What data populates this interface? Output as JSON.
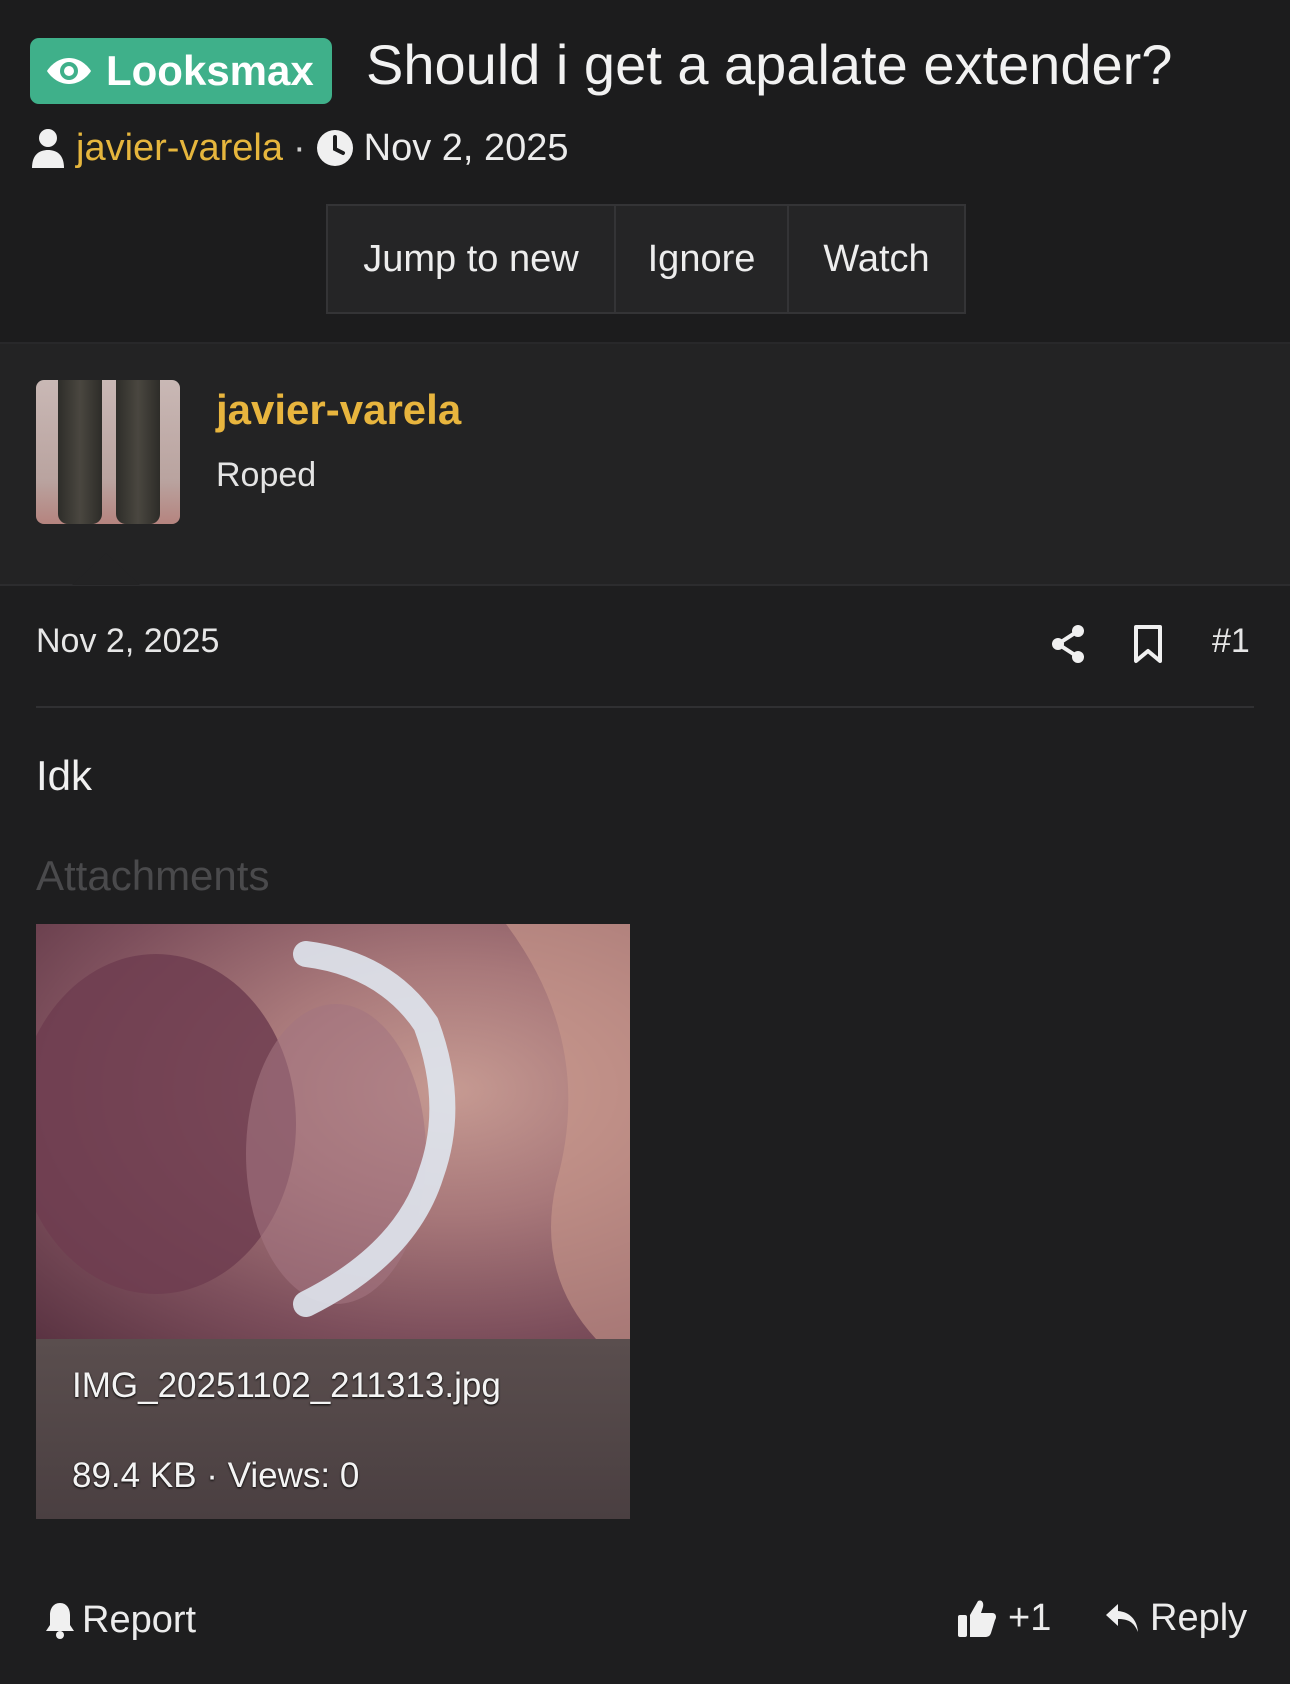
{
  "thread": {
    "prefix": "Looksmax",
    "title": "Should i get a apalate extender?",
    "author": "javier-varela",
    "separator": "·",
    "date": "Nov 2, 2025"
  },
  "actions": {
    "jump_to_new": "Jump to new",
    "ignore": "Ignore",
    "watch": "Watch"
  },
  "post": {
    "username": "javier-varela",
    "user_title": "Roped",
    "date": "Nov 2, 2025",
    "number": "#1",
    "body": "Idk",
    "attachments_label": "Attachments",
    "attachment": {
      "filename": "IMG_20251102_211313.jpg",
      "meta": "89.4 KB · Views: 0"
    },
    "footer": {
      "report": "Report",
      "like_count": "+1",
      "reply": "Reply"
    }
  },
  "colors": {
    "background": "#1e1e1f",
    "prefix_bg": "#3fb08a",
    "username": "#e8b53e"
  }
}
